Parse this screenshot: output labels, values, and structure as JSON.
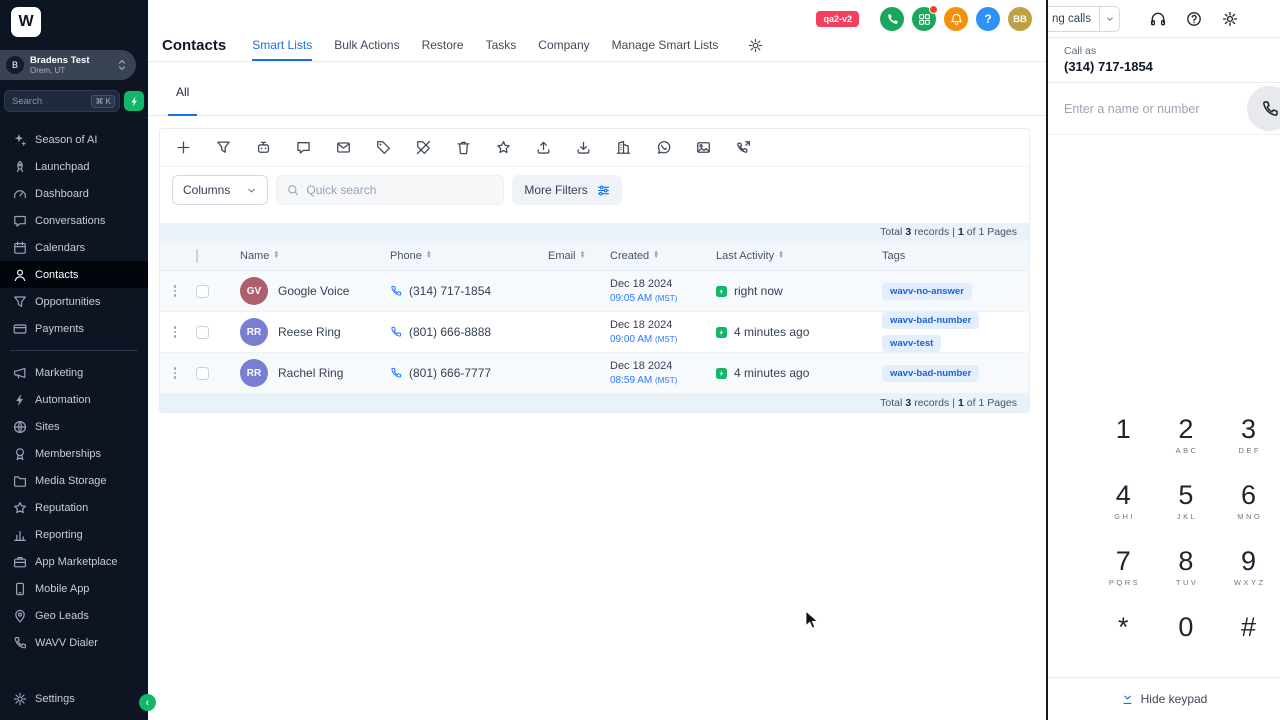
{
  "colors": {
    "sidebar_bg": "#0d1523",
    "accent_blue": "#1570ef",
    "success_green": "#12b76a",
    "warning_orange": "#f79009",
    "info_blue": "#2e90fa",
    "danger_pink": "#f4405f",
    "tag_bg": "#e2edfd",
    "tag_text": "#1b62d8",
    "avatar_bb": "#bfa145"
  },
  "sidebar": {
    "logo_text": "W",
    "account": {
      "initial": "B",
      "name": "Bradens Test",
      "location": "Orem, UT"
    },
    "search": {
      "placeholder": "Search",
      "shortcut": "⌘ K"
    },
    "items": [
      {
        "icon": "sparkles",
        "label": "Season of AI"
      },
      {
        "icon": "rocket",
        "label": "Launchpad"
      },
      {
        "icon": "dashboard",
        "label": "Dashboard"
      },
      {
        "icon": "chat",
        "label": "Conversations"
      },
      {
        "icon": "calendar",
        "label": "Calendars"
      },
      {
        "icon": "contact",
        "label": "Contacts",
        "active": true
      },
      {
        "icon": "funnel",
        "label": "Opportunities"
      },
      {
        "icon": "card",
        "label": "Payments"
      },
      {
        "divider": true
      },
      {
        "icon": "megaphone",
        "label": "Marketing"
      },
      {
        "icon": "bolt",
        "label": "Automation"
      },
      {
        "icon": "globe",
        "label": "Sites"
      },
      {
        "icon": "badge",
        "label": "Memberships"
      },
      {
        "icon": "folder",
        "label": "Media Storage"
      },
      {
        "icon": "star",
        "label": "Reputation"
      },
      {
        "icon": "chart",
        "label": "Reporting"
      },
      {
        "icon": "briefcase",
        "label": "App Marketplace"
      },
      {
        "icon": "mobile",
        "label": "Mobile App"
      },
      {
        "icon": "pin",
        "label": "Geo Leads"
      },
      {
        "icon": "phone",
        "label": "WAVV Dialer"
      }
    ],
    "settings_label": "Settings"
  },
  "topbar": {
    "env_badge": "qa2-v2",
    "icons": [
      {
        "name": "calls",
        "icon": "phone-solid",
        "bg": "#18a75c"
      },
      {
        "name": "apps",
        "icon": "grid",
        "bg": "#18a75c",
        "dot": true
      },
      {
        "name": "notifications",
        "icon": "bell",
        "bg": "#f79009"
      },
      {
        "name": "help",
        "text": "?",
        "bg": "#2e90fa"
      }
    ],
    "avatar": "BB"
  },
  "page": {
    "title": "Contacts",
    "tabs": [
      {
        "label": "Smart Lists",
        "active": true
      },
      {
        "label": "Bulk Actions"
      },
      {
        "label": "Restore"
      },
      {
        "label": "Tasks"
      },
      {
        "label": "Company"
      },
      {
        "label": "Manage Smart Lists"
      }
    ],
    "subtab": "All"
  },
  "toolbar": {
    "icons": [
      "add",
      "funnel",
      "bot",
      "chat",
      "mail",
      "tag-add",
      "tag-remove",
      "trash",
      "star",
      "export",
      "import",
      "building",
      "whatsapp",
      "image",
      "phone-out"
    ]
  },
  "filters": {
    "columns_label": "Columns",
    "search_placeholder": "Quick search",
    "more_filters_label": "More Filters"
  },
  "records_summary": {
    "total_label": "Total",
    "count": "3",
    "records_label": "records",
    "sep": "|",
    "page": "1",
    "pages_label": "of 1 Pages"
  },
  "table": {
    "headers": [
      {
        "label": "Name",
        "sortable": true
      },
      {
        "label": "Phone",
        "sortable": true
      },
      {
        "label": "Email",
        "sortable": true
      },
      {
        "label": "Created",
        "sortable": true
      },
      {
        "label": "Last Activity",
        "sortable": true
      },
      {
        "label": "Tags",
        "sortable": false
      }
    ],
    "rows": [
      {
        "initials": "GV",
        "avatar_color": "#ad5f6e",
        "name": "Google Voice",
        "phone": "(314) 717-1854",
        "email": "",
        "created_date": "Dec 18 2024",
        "created_time": "09:05 AM",
        "created_tz": "(MST)",
        "last_activity": "right now",
        "tags": [
          "wavv-no-answer"
        ]
      },
      {
        "initials": "RR",
        "avatar_color": "#787fd3",
        "name": "Reese Ring",
        "phone": "(801) 666-8888",
        "email": "",
        "created_date": "Dec 18 2024",
        "created_time": "09:00 AM",
        "created_tz": "(MST)",
        "last_activity": "4 minutes ago",
        "tags": [
          "wavv-bad-number",
          "wavv-test"
        ]
      },
      {
        "initials": "RR",
        "avatar_color": "#787fd3",
        "name": "Rachel Ring",
        "phone": "(801) 666-7777",
        "email": "",
        "created_date": "Dec 18 2024",
        "created_time": "08:59 AM",
        "created_tz": "(MST)",
        "last_activity": "4 minutes ago",
        "tags": [
          "wavv-bad-number"
        ]
      }
    ]
  },
  "dialer": {
    "calls_dropdown": "ng calls",
    "call_as_label": "Call as",
    "call_as_number": "(314) 717-1854",
    "input_placeholder": "Enter a name or number",
    "keypad": [
      {
        "digit": "1",
        "letters": ""
      },
      {
        "digit": "2",
        "letters": "ABC"
      },
      {
        "digit": "3",
        "letters": "DEF"
      },
      {
        "digit": "4",
        "letters": "GHI"
      },
      {
        "digit": "5",
        "letters": "JKL"
      },
      {
        "digit": "6",
        "letters": "MNO"
      },
      {
        "digit": "7",
        "letters": "PQRS"
      },
      {
        "digit": "8",
        "letters": "TUV"
      },
      {
        "digit": "9",
        "letters": "WXYZ"
      },
      {
        "digit": "*",
        "letters": ""
      },
      {
        "digit": "0",
        "letters": ""
      },
      {
        "digit": "#",
        "letters": ""
      }
    ],
    "hide_keypad_label": "Hide keypad"
  }
}
